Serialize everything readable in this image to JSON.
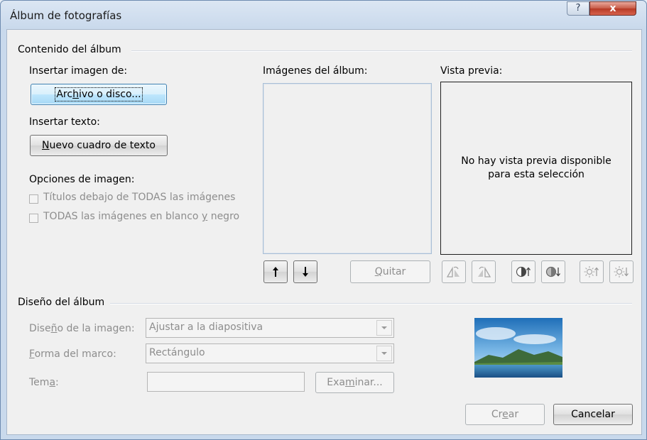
{
  "window": {
    "title": "Álbum de fotografías",
    "help_symbol": "?",
    "close_symbol": "x"
  },
  "album_content": {
    "group_label": "Contenido del álbum",
    "insert_image_label": "Insertar imagen de:",
    "file_button": {
      "pre": "Arc",
      "u": "h",
      "post": "ivo o disco..."
    },
    "insert_text_label": "Insertar texto:",
    "text_box_button": {
      "pre": "",
      "u": "N",
      "post": "uevo cuadro de texto"
    },
    "image_options_label": "Opciones de imagen:",
    "captions_option": {
      "pre": "Títulos deba",
      "u": "j",
      "post": "o de TODAS las imágenes"
    },
    "bw_option": {
      "pre": "TODAS las imágenes en blanco ",
      "u": "y",
      "post": " negro"
    }
  },
  "album_images": {
    "label": "Imágenes del álbum:",
    "remove_button": {
      "pre": "",
      "u": "Q",
      "post": "uitar"
    }
  },
  "preview": {
    "label": "Vista previa:",
    "line1": "No hay vista previa disponible",
    "line2": "para esta selección"
  },
  "album_layout": {
    "group_label": "Diseño del álbum",
    "picture_layout_label": {
      "pre": "Dise",
      "u": "ñ",
      "post": "o de la imagen:"
    },
    "picture_layout_value": "Ajustar a la diapositiva",
    "frame_shape_label": {
      "pre": "",
      "u": "F",
      "post": "orma del marco:"
    },
    "frame_shape_value": "Rectángulo",
    "theme_label": {
      "pre": "Tem",
      "u": "a",
      "post": ":"
    },
    "theme_value": "",
    "browse_button": {
      "pre": "Exa",
      "u": "m",
      "post": "inar..."
    }
  },
  "footer": {
    "create_button": {
      "pre": "Cr",
      "u": "e",
      "post": "ar"
    },
    "cancel_button": "Cancelar"
  },
  "colors": {
    "accent": "#3c7fb1",
    "disabled_text": "#8d8d8d",
    "close_red": "#c75a45"
  },
  "icons": [
    "move-up-icon",
    "move-down-icon",
    "rotate-left-icon",
    "rotate-right-icon",
    "contrast-up-icon",
    "contrast-down-icon",
    "brightness-up-icon",
    "brightness-down-icon",
    "help-icon",
    "close-icon"
  ]
}
